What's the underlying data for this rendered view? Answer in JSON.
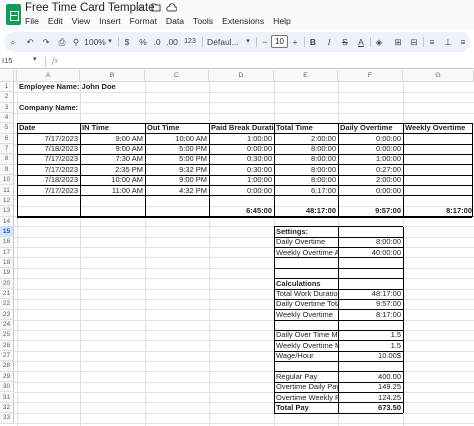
{
  "titlebar": {
    "title": "Free Time Card Template",
    "star_icon": "☆",
    "move_icon": "folder-move",
    "cloud_icon": "cloud-status",
    "menus": [
      "File",
      "Edit",
      "View",
      "Insert",
      "Format",
      "Data",
      "Tools",
      "Extensions",
      "Help"
    ]
  },
  "toolbar": {
    "search": "⌕",
    "undo": "↶",
    "redo": "↷",
    "print": "⎙",
    "paint_format": "⚲",
    "zoom": "100%",
    "zoom_caret": "▾",
    "currency": "$",
    "percent": "%",
    "dec_decrease": ".0",
    "dec_increase": ".00",
    "format_num": "123",
    "font": "Defaul...",
    "font_caret": "▾",
    "font_minus": "−",
    "font_size": "10",
    "font_plus": "+",
    "bold": "B",
    "italic": "I",
    "strike": "S",
    "text_color": "A",
    "fill": "◈",
    "borders": "⊞",
    "merge": "⊟",
    "align": "≡",
    "valign": "⊥",
    "align_more": "≡"
  },
  "formula_bar": {
    "name_box": "I15",
    "fx": "fx",
    "caret": "▾"
  },
  "columns": [
    "A",
    "B",
    "C",
    "D",
    "E",
    "F",
    "G"
  ],
  "rows": [
    "1",
    "2",
    "3",
    "4",
    "5",
    "6",
    "7",
    "8",
    "9",
    "10",
    "11",
    "12",
    "13",
    "14",
    "15",
    "16",
    "17",
    "18",
    "19",
    "20",
    "21",
    "22",
    "23",
    "24",
    "25",
    "26",
    "27",
    "28",
    "29",
    "30",
    "31",
    "32",
    "33"
  ],
  "selected_row": "15",
  "sheet": {
    "employee_label": "Employee Name: John Doe",
    "company_label": "Company Name:",
    "headers": [
      "Date",
      "IN Time",
      "Out Time",
      "Paid Break Duration",
      "Total Time",
      "Daily Overtime",
      "Weekly Overtime"
    ],
    "entries": [
      [
        "7/17/2023",
        "9:00 AM",
        "10:00 AM",
        "1:00:00",
        "2:00:00",
        "0:00:00",
        ""
      ],
      [
        "7/18/2023",
        "9:00 AM",
        "5:00 PM",
        "0:00:00",
        "8:00:00",
        "0:00:00",
        ""
      ],
      [
        "7/17/2023",
        "7:30 AM",
        "5:00 PM",
        "0:30:00",
        "8:00:00",
        "1:00:00",
        ""
      ],
      [
        "7/17/2023",
        "2:35 PM",
        "9:32 PM",
        "0:30:00",
        "8:00:00",
        "0:27:00",
        ""
      ],
      [
        "7/18/2023",
        "10:00 AM",
        "9:00 PM",
        "1:00:00",
        "8:00:00",
        "2:00:00",
        ""
      ],
      [
        "7/17/2023",
        "11:00 AM",
        "4:32 PM",
        "0:00:00",
        "6:17:00",
        "0:00:00",
        ""
      ]
    ],
    "totals": {
      "break": "6:45:00",
      "total": "48:17:00",
      "daily": "9:57:00",
      "weekly": "8:17:00"
    },
    "settings": {
      "title": "Settings:",
      "daily_ot_label": "Daily Overtime",
      "daily_ot_value": "8:00:00",
      "weekly_ot_label": "Weekly Overtime Abo",
      "weekly_ot_value": "40:00:00"
    },
    "calculations": {
      "title": "Calculations",
      "total_work_label": "Total Work Duration",
      "total_work_value": "48:17:00",
      "daily_total_label": "Daily Overtime Total",
      "daily_total_value": "9:57:00",
      "weekly_label": "Weekly Overtime",
      "weekly_value": "8:17:00",
      "daily_mult_label": "Daily Over Time Mult",
      "daily_mult_value": "1.5",
      "weekly_mult_label": "Weekly Overtime Mul",
      "weekly_mult_value": "1.5",
      "wage_label": "Wage/Hour",
      "wage_value": "10.00$",
      "regular_label": "Regular Pay",
      "regular_value": "400.00",
      "od_label": "Overtime Daily Pay",
      "od_value": "149.25",
      "ow_label": "Overtime Weekly Pay",
      "ow_value": "124.25",
      "total_label": "Total Pay",
      "total_value": "673.50"
    }
  }
}
